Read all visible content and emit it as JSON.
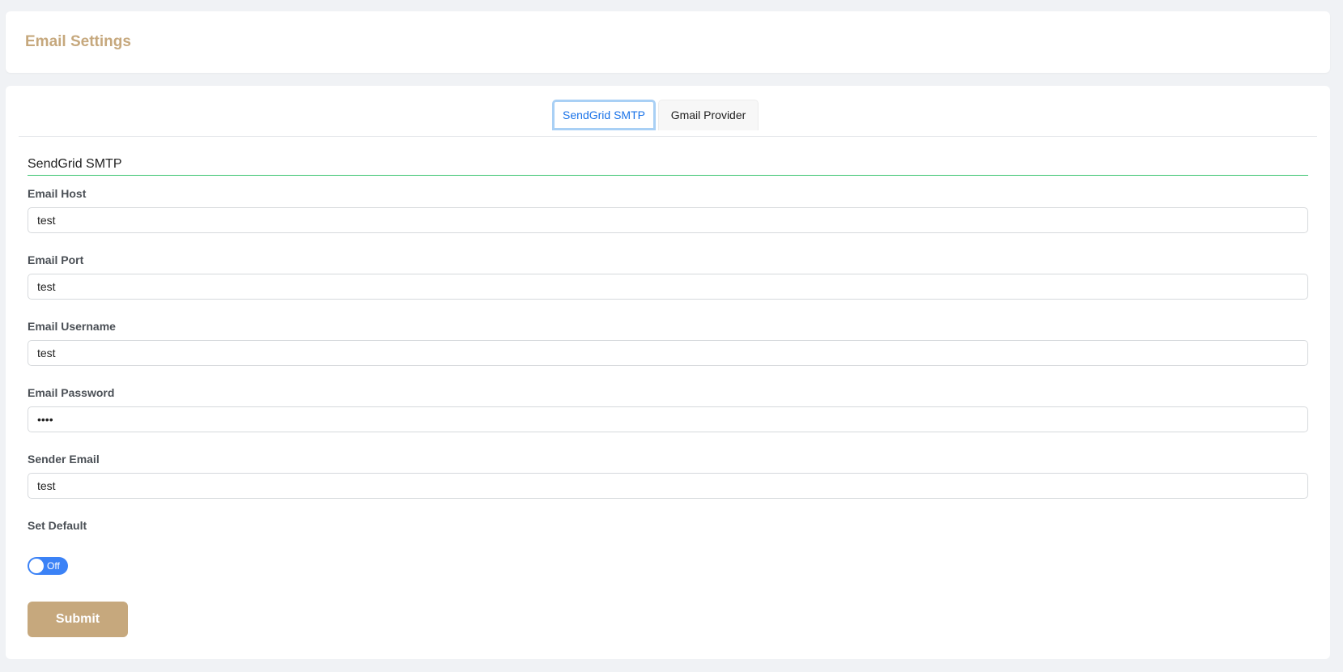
{
  "header": {
    "title": "Email Settings"
  },
  "tabs": [
    {
      "label": "SendGrid SMTP",
      "active": true
    },
    {
      "label": "Gmail Provider",
      "active": false
    }
  ],
  "section": {
    "title": "SendGrid SMTP"
  },
  "form": {
    "email_host": {
      "label": "Email Host",
      "value": "test"
    },
    "email_port": {
      "label": "Email Port",
      "value": "test"
    },
    "email_username": {
      "label": "Email Username",
      "value": "test"
    },
    "email_password": {
      "label": "Email Password",
      "value": "test"
    },
    "sender_email": {
      "label": "Sender Email",
      "value": "test"
    },
    "set_default": {
      "label": "Set Default",
      "state_label": "Off"
    }
  },
  "submit": {
    "label": "Submit"
  },
  "colors": {
    "accent": "#c6a87d",
    "tab_active_text": "#1a73e8",
    "toggle": "#3b82f6",
    "section_underline": "#3cc470"
  }
}
